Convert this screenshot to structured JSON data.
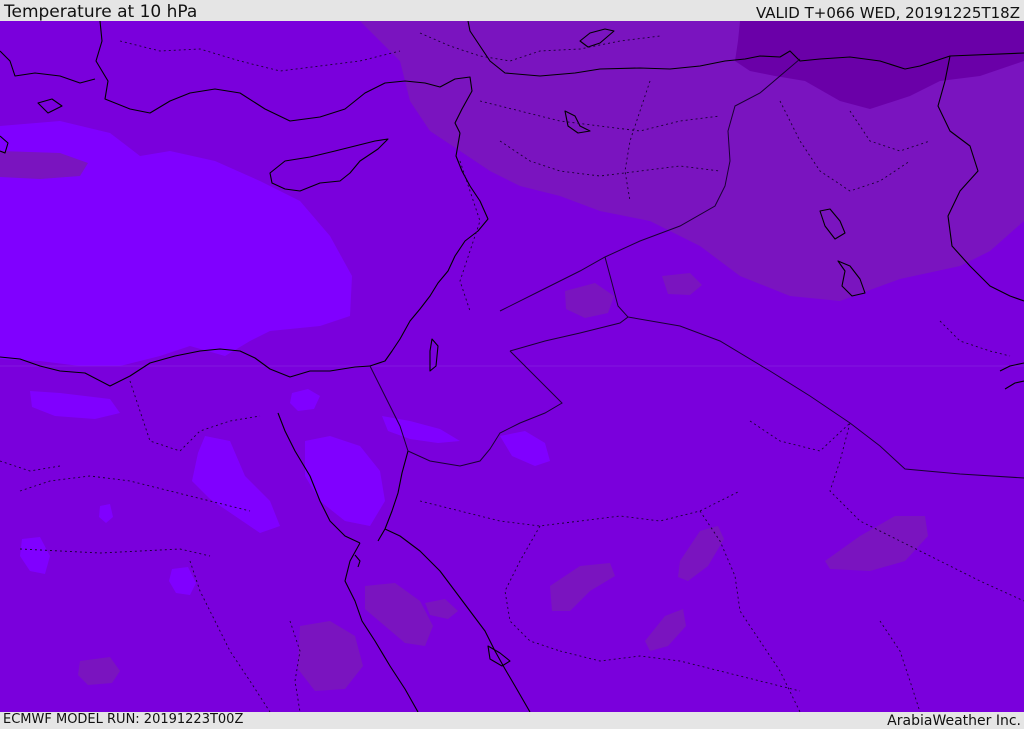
{
  "header": {
    "title": "Temperature at 10 hPa",
    "valid": "VALID T+066 WED, 20191225T18Z"
  },
  "footer": {
    "model_run": "ECMWF MODEL RUN: 20191223T00Z",
    "credit": "ArabiaWeather Inc."
  },
  "colors": {
    "base_field": "#7a00dc",
    "warm_pocket": "#8000ff",
    "cool_pocket": "#7a14bf",
    "cold_core": "#6a00a8",
    "coastline": "#000000",
    "border": "#1a0033"
  }
}
